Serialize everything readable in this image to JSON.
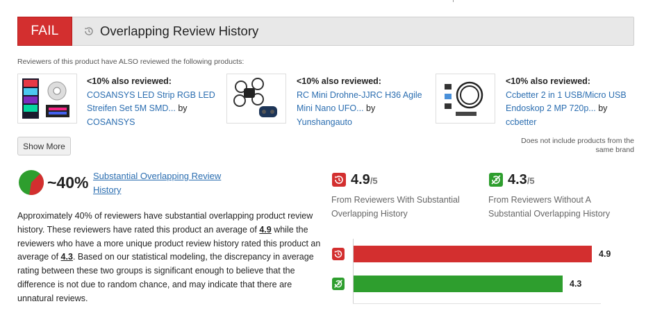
{
  "header": {
    "status": "FAIL",
    "title": "Overlapping Review History"
  },
  "intro": "Reviewers of this product have ALSO reviewed the following products:",
  "products": [
    {
      "also": "<10% also reviewed:",
      "name": "COSANSYS LED Strip RGB LED Streifen Set 5M SMD...",
      "by": "by",
      "brand": "COSANSYS"
    },
    {
      "also": "<10% also reviewed:",
      "name": "RC Mini Drohne-JJRC H36 Agile Mini Nano UFO...",
      "by": "by",
      "brand": "Yunshangauto"
    },
    {
      "also": "<10% also reviewed:",
      "name": "Ccbetter 2 in 1 USB/Micro USB Endoskop 2 MP 720p...",
      "by": "by",
      "brand": "ccbetter"
    }
  ],
  "show_more": "Show More",
  "note": "Does not include products from the same brand",
  "summary": {
    "percent": "~40%",
    "label": "Substantial Overlapping Review History",
    "pie_fraction": 0.4
  },
  "description": {
    "p1": "Approximately 40% of reviewers have substantial overlapping product review history. These reviewers have rated this product an average of ",
    "v1": "4.9",
    "p2": " while the reviewers who have a more unique product review history rated this product an average of ",
    "v2": "4.3",
    "p3": ". Based on our statistical modeling, the discrepancy in average rating between these two groups is significant enough to believe that the difference is not due to random chance, and may indicate that there are unnatural reviews."
  },
  "ratings": [
    {
      "score": "4.9",
      "denom": "/5",
      "label": "From Reviewers With Substantial Overlapping History",
      "color": "#d32f2f",
      "icon": "history-icon"
    },
    {
      "score": "4.3",
      "denom": "/5",
      "label": "From Reviewers Without A Substantial Overlapping History",
      "color": "#2e9e2e",
      "icon": "no-history-icon"
    }
  ],
  "chart_data": {
    "type": "bar",
    "orientation": "horizontal",
    "categories": [
      "With Substantial Overlapping History",
      "Without Substantial Overlapping History"
    ],
    "values": [
      4.9,
      4.3
    ],
    "value_labels": [
      "4.9",
      "4.3"
    ],
    "colors": [
      "#d32f2f",
      "#2e9e2e"
    ],
    "xlim": [
      0,
      5
    ]
  }
}
